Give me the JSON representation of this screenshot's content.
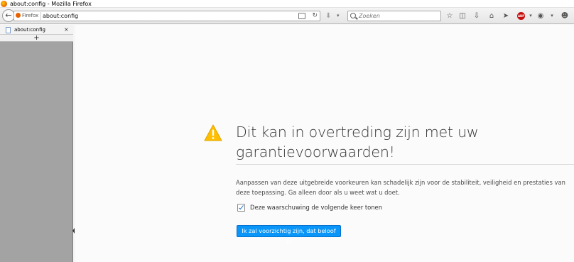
{
  "window": {
    "title": "about:config - Mozilla Firefox"
  },
  "navbar": {
    "identity_label": "Firefox",
    "url": "about:config",
    "search_placeholder": "Zoeken"
  },
  "sidebar": {
    "tabs": [
      {
        "label": "about:config",
        "close": "×"
      }
    ],
    "new_tab": "+"
  },
  "warning": {
    "heading": "Dit kan in overtreding zijn met uw garantievoorwaarden!",
    "description": "Aanpassen van deze uitgebreide voorkeuren kan schadelijk zijn voor de stabiliteit, veiligheid en prestaties van deze toepassing. Ga alleen door als u weet wat u doet.",
    "checkbox_label": "Deze waarschuwing de volgende keer tonen",
    "checkbox_checked": true,
    "button_label": "Ik zal voorzichtig zijn, dat beloof ik!"
  },
  "colors": {
    "accent": "#0996f8",
    "warning": "#ffbf00"
  },
  "icons": [
    "firefox-logo",
    "back-arrow-icon",
    "reader-view-icon",
    "reload-icon",
    "download-icon",
    "search-icon",
    "bookmark-star-icon",
    "clipboard-icon",
    "downloads-icon",
    "home-icon",
    "send-icon",
    "adblock-icon",
    "pocket-icon",
    "menu-dropdown-icon",
    "chat-icon",
    "warning-icon"
  ]
}
